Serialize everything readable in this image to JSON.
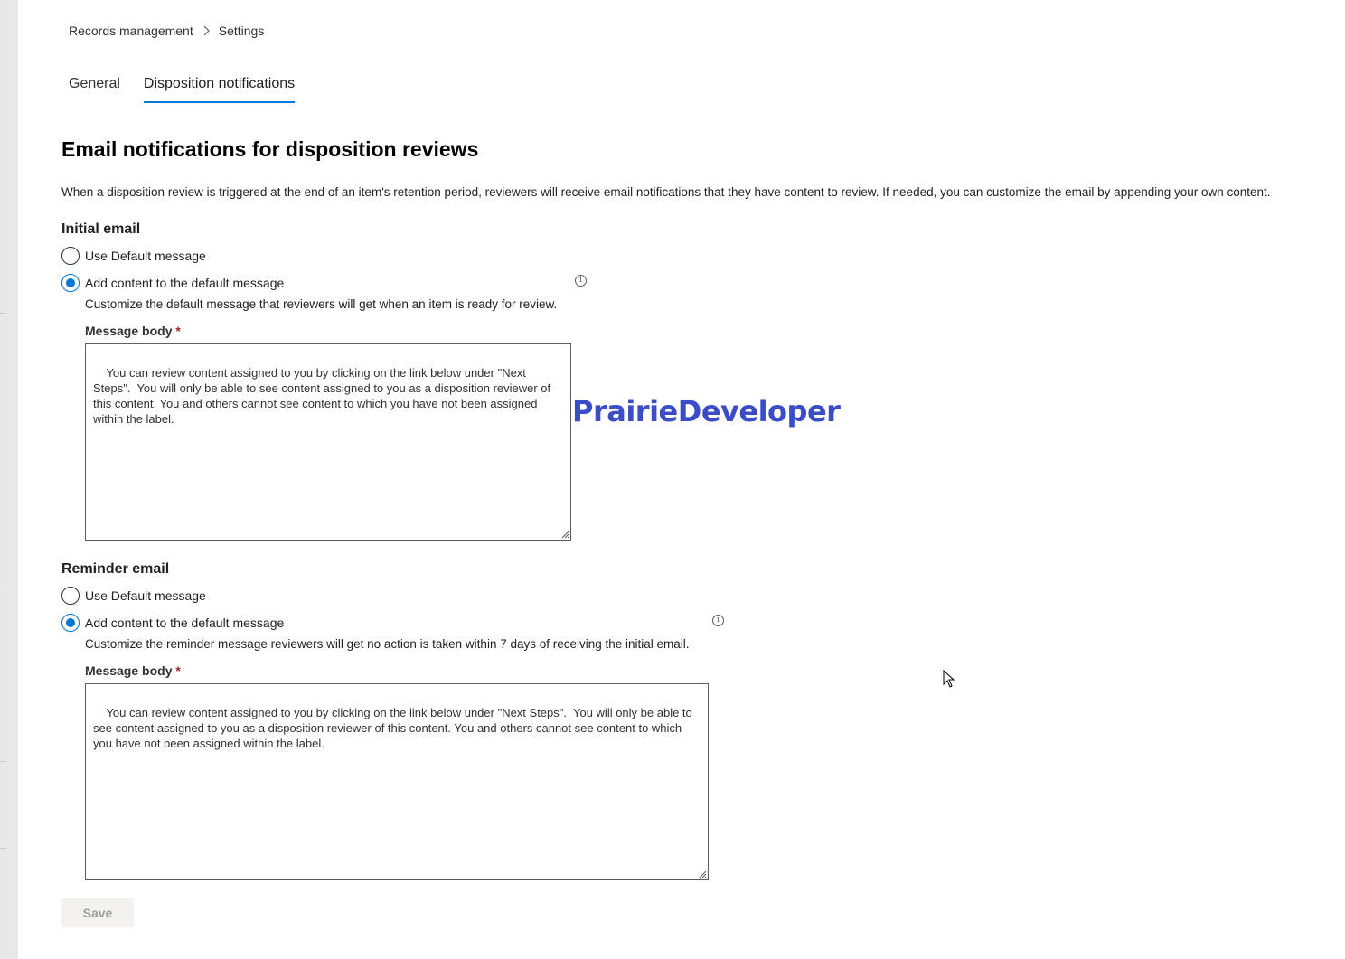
{
  "breadcrumb": {
    "items": [
      "Records management",
      "Settings"
    ]
  },
  "tabs": [
    {
      "label": "General",
      "active": false
    },
    {
      "label": "Disposition notifications",
      "active": true
    }
  ],
  "page": {
    "title": "Email notifications for disposition reviews",
    "intro": "When a disposition review is triggered at the end of an item's retention period, reviewers will receive email notifications that they have content to review. If needed, you can customize the email by appending your own content."
  },
  "initial_email": {
    "title": "Initial email",
    "option_default": "Use Default message",
    "option_add": "Add content to the default message",
    "selected": "Add content to the default message",
    "help": "Customize the default message that reviewers will get when an item is ready for review.",
    "field_label": "Message body",
    "required_mark": "*",
    "value": "You can review content assigned to you by clicking on the link below under \"Next Steps\".  You will only be able to see content assigned to you as a disposition reviewer of this content. You and others cannot see content to which you have not been assigned within the label."
  },
  "reminder_email": {
    "title": "Reminder email",
    "option_default": "Use Default message",
    "option_add": "Add content to the default message",
    "selected": "Add content to the default message",
    "help": "Customize the reminder message reviewers will get no action is taken within 7 days of receiving the initial email.",
    "field_label": "Message body",
    "required_mark": "*",
    "value": "You can review content assigned to you by clicking on the link below under \"Next Steps\".  You will only be able to see content assigned to you as a disposition reviewer of this content. You and others cannot see content to which you have not been assigned within the label."
  },
  "watermark": "PrairieDeveloper",
  "actions": {
    "save_label": "Save",
    "save_enabled": false
  },
  "icons": {
    "breadcrumb_separator": "chevron-right-icon",
    "info": "info-icon",
    "cursor": "mouse-pointer-icon"
  },
  "colors": {
    "accent": "#0078d4",
    "watermark": "#3b4cc8",
    "required": "#a4262c"
  }
}
